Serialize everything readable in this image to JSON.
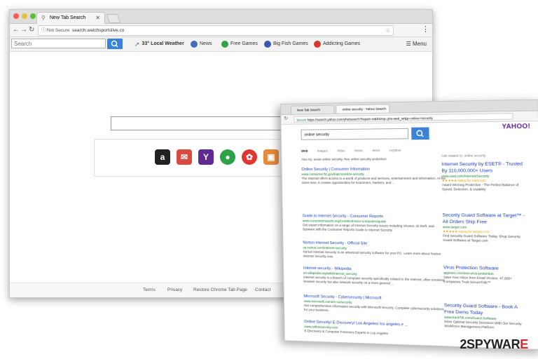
{
  "browser1": {
    "tab_title": "New Tab Search",
    "url_secure_label": "Not Secure",
    "url": "search.watchsportslive.co",
    "toolbar": {
      "search_placeholder": "Search",
      "weather": "33° Local Weather",
      "items": [
        "News",
        "Free Games",
        "Big Fish Games",
        "Addicting Games"
      ],
      "menu_label": "Menu"
    },
    "footer": [
      "Terms",
      "Privacy",
      "Restore Chrome Tab Page",
      "Contact"
    ],
    "shortcut_icons": [
      "amazon-icon",
      "gmail-icon",
      "yahoo-icon",
      "contacts-icon",
      "games-icon",
      "photos-icon"
    ]
  },
  "browser2": {
    "tabs": [
      "New Tab Search",
      "online security - Yahoo Search"
    ],
    "secure_label": "Secure",
    "url": "https://search.yahoo.com/yhs/search?hspart=w&hsimp=yhs-web_wt&p=online+security",
    "search_value": "online security",
    "logo": "YAHOO!",
    "nav_tabs": [
      "Web",
      "Images",
      "Video",
      "News",
      "More",
      "Anytime"
    ],
    "also_try": "Also try: avast online security, free online security protection",
    "ads_header": "Ads related to: online security",
    "results": [
      {
        "title": "Online Security | Consumer Information",
        "url": "www.consumer.ftc.gov/topics/online-security",
        "snippet": "The Internet offers access to a world of products and services, entertainment and information. At the same time, it creates opportunities for scammers, hackers, and ..."
      },
      {
        "title": "Guide to Internet Security - Consumer Reports",
        "url": "www.consumerreports.org/cro/electronics-computers/guide",
        "snippet": "Get expert information on a range of Internet Security issues including Viruses, ID theft, and Spyware with the Consumer Reports Guide to Internet Security"
      },
      {
        "title": "Norton Internet Security - Official Site",
        "url": "us.norton.com/internet-security",
        "snippet": "Norton Internet Security is an advanced security software for your PC. Learn more about Norton Internet Security now."
      },
      {
        "title": "Internet security - Wikipedia",
        "url": "en.wikipedia.org/wiki/Internet_security",
        "snippet": "Internet security is a branch of computer security specifically related to the Internet, often involving browser security but also network security on a more general ..."
      },
      {
        "title": "Microsoft Security - Cybersecurity | Microsoft",
        "url": "www.microsoft.com/en-us/security",
        "snippet": "Get comprehensive information security with Microsoft Security. Complete cybersecurity solutions for your business."
      },
      {
        "title": "Online Security/ E-Discovery/ Los Angeles/ los angeles e ...",
        "url": "www.onlinesecurity.com",
        "snippet": "E-Discovery & Computer Forensics Experts in Los Angeles"
      }
    ],
    "ads": [
      {
        "title": "Internet Security by ESET® - Trusted By 110,000,000+ Users",
        "url": "www.eset.com/Internet/Security",
        "snippet": "Award Winning Protection - The Perfect Balance of Speed, Detection, & Usability",
        "rating": "★★★★★ rating for eset.com"
      },
      {
        "title": "Security Guard Software at Target™ - All Orders Ship Free",
        "url": "www.target.com",
        "snippet": "Find Security Guard Software Today. Shop Security Guard Software at Target.com",
        "rating": "★★★★★ rating for target.com"
      },
      {
        "title": "Virus Protection Software",
        "url": "appriver.com/anti-virus-protection",
        "snippet": "Save Your Inbox from Email Viruses. 47,000+ Companies Trust SecureTide™"
      },
      {
        "title": "Security Guard Software - Book A Free Demo Today",
        "url": "www.trackTik.com/Guard-Software",
        "snippet": "Drive Optimal Security Decisions With Our Security Workforce Management Platform"
      }
    ]
  },
  "watermark": {
    "part1": "2SPYWAR",
    "part2": "E"
  },
  "colors": {
    "search_blue": "#3b83d8",
    "link_blue": "#1a3eb5",
    "url_green": "#0a7a2d",
    "yahoo_purple": "#5f1d9c"
  }
}
